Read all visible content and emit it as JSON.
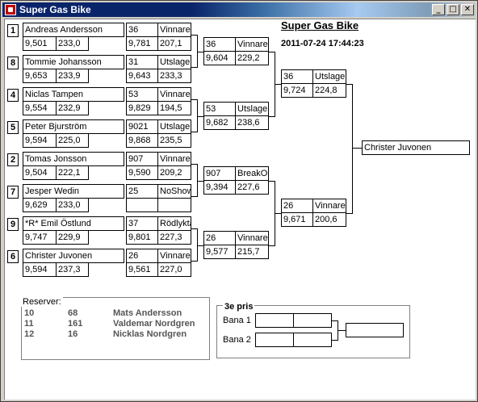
{
  "window": {
    "title": "Super Gas Bike",
    "min": "_",
    "max": "□",
    "close": "✕"
  },
  "header": {
    "title": "Super Gas Bike",
    "datetime": "2011-07-24 17:44:23"
  },
  "round1": [
    {
      "seed": "1",
      "name": "Andreas Andersson",
      "time": "9,501",
      "speed": "233,0"
    },
    {
      "seed": "8",
      "name": "Tommie Johansson",
      "time": "9,653",
      "speed": "233,9"
    },
    {
      "seed": "4",
      "name": "Niclas Tampen",
      "time": "9,554",
      "speed": "232,9"
    },
    {
      "seed": "5",
      "name": "Peter Bjurström",
      "time": "9,594",
      "speed": "225,0"
    },
    {
      "seed": "2",
      "name": "Tomas Jonsson",
      "time": "9,504",
      "speed": "222,1"
    },
    {
      "seed": "7",
      "name": "Jesper Wedin",
      "time": "9,629",
      "speed": "233,0"
    },
    {
      "seed": "9",
      "name": "*R* Emil Östlund",
      "time": "9,747",
      "speed": "229,9"
    },
    {
      "seed": "6",
      "name": "Christer Juvonen",
      "time": "9,594",
      "speed": "237,3"
    }
  ],
  "round2": [
    {
      "num": "36",
      "result": "Vinnare",
      "time": "9,781",
      "speed": "207,1"
    },
    {
      "num": "31",
      "result": "Utslagen",
      "time": "9,643",
      "speed": "233,3"
    },
    {
      "num": "53",
      "result": "Vinnare",
      "time": "9,829",
      "speed": "194,5"
    },
    {
      "num": "9021",
      "result": "Utslagen",
      "time": "9,868",
      "speed": "235,5"
    },
    {
      "num": "907",
      "result": "Vinnare",
      "time": "9,590",
      "speed": "209,2"
    },
    {
      "num": "25",
      "result": "NoShow",
      "time": "",
      "speed": ""
    },
    {
      "num": "37",
      "result": "Rödlykta",
      "time": "9,801",
      "speed": "227,3"
    },
    {
      "num": "26",
      "result": "Vinnare",
      "time": "9,561",
      "speed": "227,0"
    }
  ],
  "round3": [
    {
      "num": "36",
      "result": "Vinnare",
      "time": "9,604",
      "speed": "229,2"
    },
    {
      "num": "53",
      "result": "Utslagen",
      "time": "9,682",
      "speed": "238,6"
    },
    {
      "num": "907",
      "result": "BreakOut",
      "time": "9,394",
      "speed": "227,6"
    },
    {
      "num": "26",
      "result": "Vinnare",
      "time": "9,577",
      "speed": "215,7"
    }
  ],
  "round4": [
    {
      "num": "36",
      "result": "Utslagen",
      "time": "9,724",
      "speed": "224,8"
    },
    {
      "num": "26",
      "result": "Vinnare",
      "time": "9,671",
      "speed": "200,6"
    }
  ],
  "winner": "Christer Juvonen",
  "reserves": {
    "label": "Reserver:",
    "rows": [
      {
        "pos": "10",
        "num": "68",
        "name": "Mats Andersson"
      },
      {
        "pos": "11",
        "num": "161",
        "name": "Valdemar Nordgren"
      },
      {
        "pos": "12",
        "num": "16",
        "name": "Nicklas Nordgren"
      }
    ]
  },
  "third_place": {
    "label": "3e pris",
    "lane1": "Bana 1",
    "lane2": "Bana 2"
  }
}
